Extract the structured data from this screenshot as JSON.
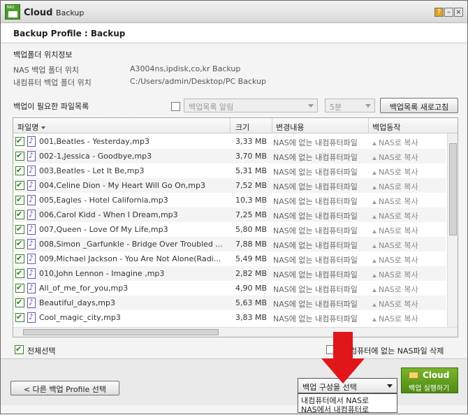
{
  "window": {
    "logo_text": "NAS",
    "title_main": "Cloud",
    "title_sub": "Backup",
    "help_label": "?",
    "min_label": "–",
    "close_label": "×"
  },
  "profile": {
    "title": "Backup Profile : Backup"
  },
  "location": {
    "heading": "백업폴더 위치정보",
    "nas_label": "NAS 백업 폴더 위치",
    "nas_value": "A3004ns,ipdisk,co,kr  Backup",
    "pc_label": "내컴퓨터 백업 폴더 위치",
    "pc_value": "C:/Users/admin/Desktop/PC Backup"
  },
  "filelist": {
    "heading": "백업이 필요한 파일목록",
    "alert_select": "백업목록 알림",
    "interval_select": "5분",
    "refresh_button": "백업목록 새로고침",
    "columns": {
      "name": "파일명",
      "size": "크기",
      "change": "변경내용",
      "action": "백업동작"
    },
    "rows": [
      {
        "name": "001,Beatles - Yesterday,mp3",
        "size": "3,33 MB",
        "change": "NAS에 없는 내컴퓨터파일",
        "action": "NAS로 복사"
      },
      {
        "name": "002-1,Jessica - Goodbye,mp3",
        "size": "3,70 MB",
        "change": "NAS에 없는 내컴퓨터파일",
        "action": "NAS로 복사"
      },
      {
        "name": "003,Beatles - Let It Be,mp3",
        "size": "5,31 MB",
        "change": "NAS에 없는 내컴퓨터파일",
        "action": "NAS로 복사"
      },
      {
        "name": "004,Celine Dion - My Heart Will Go On,mp3",
        "size": "7,52 MB",
        "change": "NAS에 없는 내컴퓨터파일",
        "action": "NAS로 복사"
      },
      {
        "name": "005,Eagles - Hotel California,mp3",
        "size": "10,3 MB",
        "change": "NAS에 없는 내컴퓨터파일",
        "action": "NAS로 복사"
      },
      {
        "name": "006,Carol Kidd - When I Dream,mp3",
        "size": "7,25 MB",
        "change": "NAS에 없는 내컴퓨터파일",
        "action": "NAS로 복사"
      },
      {
        "name": "007,Queen - Love Of My Life,mp3",
        "size": "5,80 MB",
        "change": "NAS에 없는 내컴퓨터파일",
        "action": "NAS로 복사"
      },
      {
        "name": "008,Simon _Garfunkle - Bridge Over Troubled ...",
        "size": "7,88 MB",
        "change": "NAS에 없는 내컴퓨터파일",
        "action": "NAS로 복사"
      },
      {
        "name": "009,Michael Jackson - You Are Not Alone(Radi...",
        "size": "5,49 MB",
        "change": "NAS에 없는 내컴퓨터파일",
        "action": "NAS로 복사"
      },
      {
        "name": "010,John Lennon - Imagine ,mp3",
        "size": "2,82 MB",
        "change": "NAS에 없는 내컴퓨터파일",
        "action": "NAS로 복사"
      },
      {
        "name": "All_of_me_for_you,mp3",
        "size": "4,90 MB",
        "change": "NAS에 없는 내컴퓨터파일",
        "action": "NAS로 복사"
      },
      {
        "name": "Beautiful_days,mp3",
        "size": "5,63 MB",
        "change": "NAS에 없는 내컴퓨터파일",
        "action": "NAS로 복사"
      },
      {
        "name": "Cool_magic_city,mp3",
        "size": "3,83 MB",
        "change": "NAS에 없는 내컴퓨터파일",
        "action": "NAS로 복사"
      }
    ]
  },
  "footer": {
    "select_all": "전체선택",
    "delete_nas_only": "컴퓨터에 없는 NAS파일 삭제",
    "other_profile_button": "< 다른 백업 Profile 선택",
    "backup_config_select": "백업 구성을 선택",
    "backup_config_options": [
      "내컴퓨터에서 NAS로",
      "NAS에서 내컴퓨터로"
    ],
    "run_button_title": "Cloud",
    "run_button_sub": "백업 실행하기"
  },
  "colors": {
    "accent_green": "#4f8a14",
    "annotation_red": "#e0161b"
  }
}
